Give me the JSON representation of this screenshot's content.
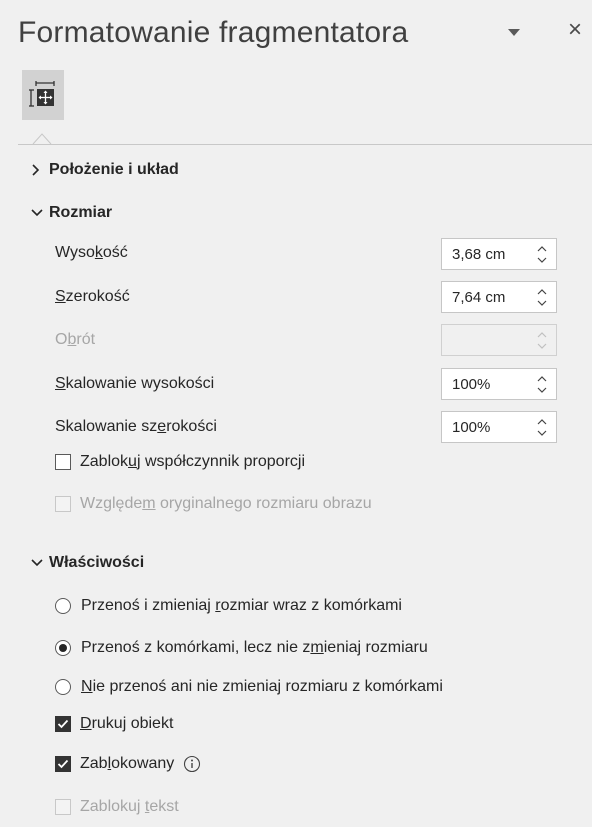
{
  "pane": {
    "title": "Formatowanie fragmentatora",
    "close_glyph": "×",
    "tab_icon": "size-properties-icon"
  },
  "sections": {
    "position_layout": {
      "label": "Położenie i układ",
      "expanded": false
    },
    "size": {
      "label": "Rozmiar",
      "expanded": true
    },
    "properties": {
      "label": "Właściwości",
      "expanded": true
    }
  },
  "size": {
    "height": {
      "label_pre": "Wyso",
      "label_u": "k",
      "label_post": "ość",
      "value": "3,68  cm"
    },
    "width": {
      "label_pre": "",
      "label_u": "S",
      "label_post": "zerokość",
      "value": "7,64  cm"
    },
    "rotation": {
      "label_pre": "O",
      "label_u": "b",
      "label_post": "rót",
      "value": "",
      "disabled": true
    },
    "scale_height": {
      "label_pre": "",
      "label_u": "S",
      "label_post": "kalowanie wysokości",
      "value": "100%"
    },
    "scale_width": {
      "label_pre": "Skalowanie sz",
      "label_u": "e",
      "label_post": "rokości",
      "value": "100%"
    },
    "lock_aspect": {
      "label_pre": "Zablok",
      "label_u": "u",
      "label_post": "j współczynnik proporcji",
      "checked": false
    },
    "relative_original": {
      "label_pre": "Względe",
      "label_u": "m",
      "label_post": " oryginalnego rozmiaru obrazu",
      "checked": false,
      "disabled": true
    }
  },
  "properties": {
    "radio_options": [
      {
        "label_pre": "Przenoś i zmieniaj ",
        "label_u": "r",
        "label_post": "ozmiar wraz z komórkami",
        "selected": false
      },
      {
        "label_pre": "Przenoś z komórkami, lecz nie z",
        "label_u": "m",
        "label_post": "ieniaj rozmiaru",
        "selected": true
      },
      {
        "label_pre": "",
        "label_u": "N",
        "label_post": "ie przenoś ani nie zmieniaj rozmiaru z komórkami",
        "selected": false
      }
    ],
    "print_object": {
      "label_pre": "",
      "label_u": "D",
      "label_post": "rukuj obiekt",
      "checked": true
    },
    "locked": {
      "label_pre": "Zab",
      "label_u": "l",
      "label_post": "okowany",
      "checked": true
    },
    "lock_text": {
      "label_pre": "Zablokuj ",
      "label_u": "t",
      "label_post": "ekst",
      "checked": false,
      "disabled": true
    }
  },
  "colors": {
    "background": "#f0f0f0",
    "text": "#262626",
    "disabled_text": "#a6a6a6",
    "selected_tab": "#d2d2d2"
  }
}
